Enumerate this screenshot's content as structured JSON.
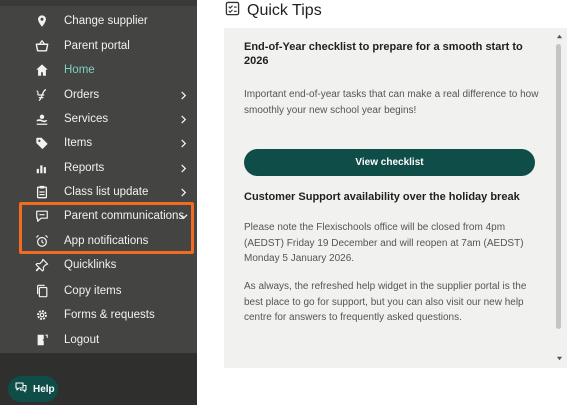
{
  "sidebar": {
    "items": [
      {
        "label": "Change supplier",
        "icon": "map-pin-icon",
        "has_chevron": false
      },
      {
        "label": "Parent portal",
        "icon": "basket-icon",
        "has_chevron": false
      },
      {
        "label": "Home",
        "icon": "home-icon",
        "has_chevron": false,
        "active": true
      },
      {
        "label": "Orders",
        "icon": "orders-icon",
        "has_chevron": true
      },
      {
        "label": "Services",
        "icon": "services-icon",
        "has_chevron": true
      },
      {
        "label": "Items",
        "icon": "tag-icon",
        "has_chevron": true
      },
      {
        "label": "Reports",
        "icon": "bar-chart-icon",
        "has_chevron": true
      },
      {
        "label": "Class list update",
        "icon": "clipboard-icon",
        "has_chevron": true
      },
      {
        "label": "Parent communications",
        "icon": "chat-icon",
        "has_chevron": true,
        "expanded": true
      },
      {
        "label": "App notifications",
        "icon": "alarm-icon",
        "has_chevron": false
      },
      {
        "label": "Quicklinks",
        "icon": "pin-icon",
        "has_chevron": false
      },
      {
        "label": "Copy items",
        "icon": "copy-icon",
        "has_chevron": false
      },
      {
        "label": "Forms & requests",
        "icon": "gear-icon",
        "has_chevron": false
      },
      {
        "label": "Logout",
        "icon": "logout-icon",
        "has_chevron": false
      }
    ],
    "help_label": "Help"
  },
  "main": {
    "title": "Quick Tips",
    "panel": {
      "heading1": "End-of-Year checklist to prepare for a smooth start to 2026",
      "para1": "Important end-of-year tasks that can make a real difference to how smoothly your new school year begins!",
      "button_label": "View checklist",
      "heading2": "Customer Support availability over the holiday break",
      "para2": "Please note the Flexischools office will be closed from 4pm (AEDST) Friday 19 December and will reopen at 7am (AEDST) Monday 5 January 2026.",
      "para3": "As always, the refreshed help widget in the supplier portal is the best place to go for support, but you can also visit our new help centre for answers to frequently asked questions."
    }
  },
  "colors": {
    "sidebar_bg": "#444442",
    "accent": "#0f4d48",
    "active_text": "#7dd3c0",
    "highlight": "#f26b21",
    "panel_bg": "#f1f1f0"
  }
}
